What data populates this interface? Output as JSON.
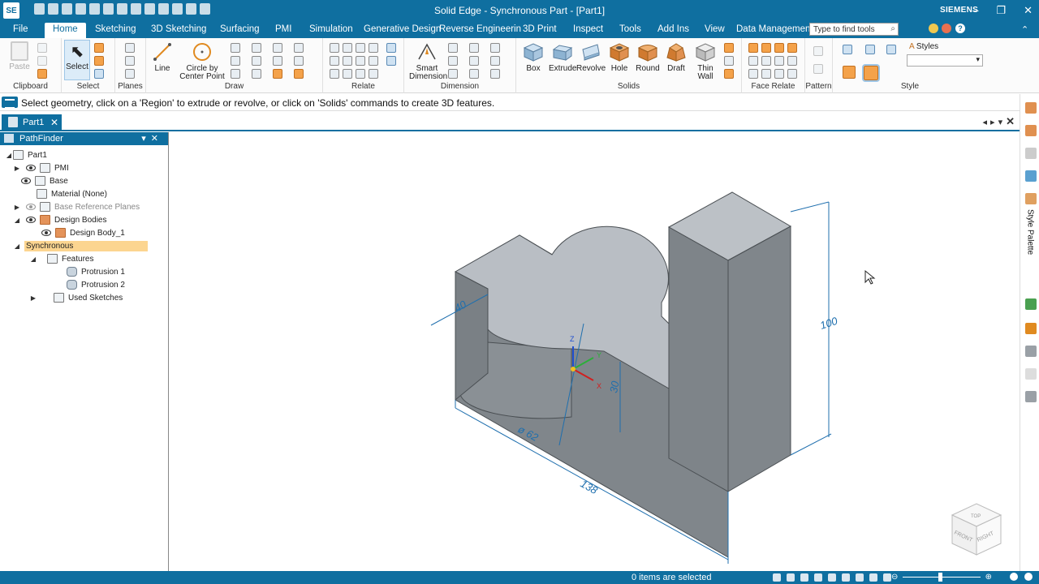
{
  "app": {
    "logo": "SE",
    "title": "Solid Edge - Synchronous Part - [Part1]",
    "brand": "SIEMENS",
    "window_controls": [
      "minimize-icon",
      "restore-icon",
      "close-icon"
    ]
  },
  "menu": {
    "file": "File",
    "tabs": [
      "Home",
      "Sketching",
      "3D Sketching",
      "Surfacing",
      "PMI",
      "Simulation",
      "Generative Design",
      "Reverse Engineerin",
      "3D Print",
      "Inspect",
      "Tools",
      "Add Ins",
      "View",
      "Data Management"
    ],
    "active_tab": "Home",
    "search_placeholder": "Type to find tools"
  },
  "ribbon": {
    "groups": {
      "clipboard": "Clipboard",
      "select": "Select",
      "planes": "Planes",
      "draw": "Draw",
      "relate": "Relate",
      "dimension": "Dimension",
      "solids": "Solids",
      "face_relate": "Face Relate",
      "pattern": "Pattern",
      "style": "Style"
    },
    "buttons": {
      "paste": "Paste",
      "select": "Select",
      "line": "Line",
      "circle_1": "Circle by",
      "circle_2": "Center Point",
      "smart_dim_1": "Smart",
      "smart_dim_2": "Dimension",
      "box": "Box",
      "extrude": "Extrude",
      "revolve": "Revolve",
      "hole": "Hole",
      "round": "Round",
      "draft": "Draft",
      "thin_wall_1": "Thin",
      "thin_wall_2": "Wall",
      "styles": "Styles"
    }
  },
  "prompt": "Select geometry, click on a 'Region' to extrude or revolve, or click on 'Solids' commands to create 3D features.",
  "document_tab": "Part1",
  "pathfinder": {
    "title": "PathFinder",
    "tree": {
      "root": "Part1",
      "pmi": "PMI",
      "base": "Base",
      "material": "Material (None)",
      "ref_planes": "Base Reference Planes",
      "design_bodies": "Design Bodies",
      "design_body_1": "Design Body_1",
      "synchronous": "Synchronous",
      "features": "Features",
      "protrusion_1": "Protrusion 1",
      "protrusion_2": "Protrusion 2",
      "used_sketches": "Used Sketches"
    }
  },
  "viewport": {
    "dimensions": {
      "d_small": "40",
      "diameter": "ø 62",
      "height_boss": "30",
      "length": "138",
      "height": "100"
    },
    "axes": {
      "x": "X",
      "y": "Y",
      "z": "Z"
    },
    "view_cube": {
      "top": "TOP",
      "front": "FRONT",
      "right": "RIGHT"
    },
    "colors": {
      "part_face_top": "#b9bec4",
      "part_face_dark": "#7e8489",
      "dimension": "#1f6fae"
    }
  },
  "right_panel": {
    "style_palette": "Style Palette"
  },
  "status": {
    "message": "0 items are selected"
  }
}
